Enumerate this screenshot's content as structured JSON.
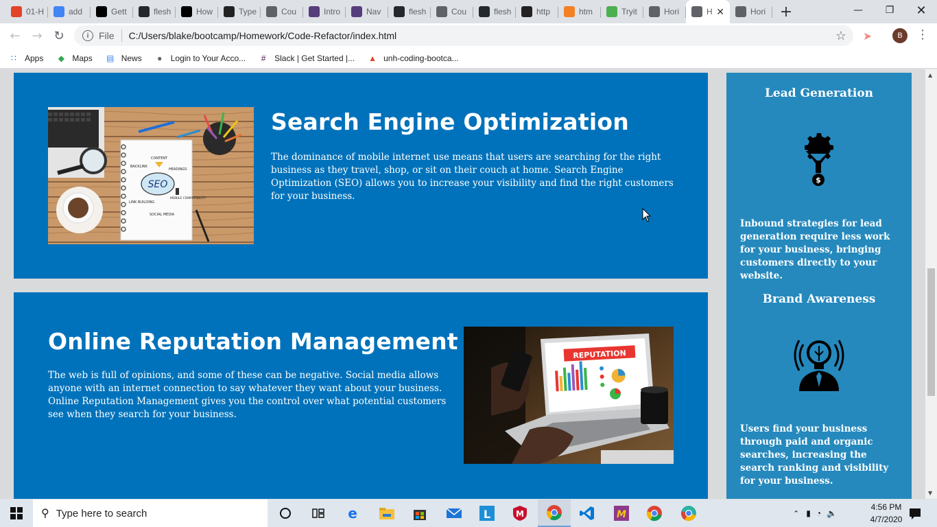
{
  "browser": {
    "tabs": [
      {
        "label": "01-H",
        "icon": "gitlab-icon",
        "color": "#e24329"
      },
      {
        "label": "add",
        "icon": "google-icon",
        "color": "#4285f4"
      },
      {
        "label": "Gett",
        "icon": "medium-icon",
        "color": "#000000"
      },
      {
        "label": "flesh",
        "icon": "github-icon",
        "color": "#24292e"
      },
      {
        "label": "How",
        "icon": "medium-icon",
        "color": "#000000"
      },
      {
        "label": "Type",
        "icon": "typeit-icon",
        "color": "#222222"
      },
      {
        "label": "Cou",
        "icon": "globe-icon",
        "color": "#5f6368"
      },
      {
        "label": "Intro",
        "icon": "bootstrap-icon",
        "color": "#563d7c"
      },
      {
        "label": "Nav",
        "icon": "bootstrap-icon",
        "color": "#563d7c"
      },
      {
        "label": "flesh",
        "icon": "github-icon",
        "color": "#24292e"
      },
      {
        "label": "Cou",
        "icon": "globe-icon",
        "color": "#5f6368"
      },
      {
        "label": "flesh",
        "icon": "github-icon",
        "color": "#24292e"
      },
      {
        "label": "http",
        "icon": "skull-icon",
        "color": "#222222"
      },
      {
        "label": "htm",
        "icon": "stackoverflow-icon",
        "color": "#f48024"
      },
      {
        "label": "Tryit",
        "icon": "w3schools-icon",
        "color": "#4caf50"
      },
      {
        "label": "Hori",
        "icon": "globe-icon",
        "color": "#5f6368"
      },
      {
        "label": "H",
        "icon": "globe-icon",
        "color": "#5f6368",
        "active": true
      },
      {
        "label": "Hori",
        "icon": "globe-icon",
        "color": "#5f6368"
      }
    ],
    "address": {
      "scheme_label": "File",
      "url": "C:/Users/blake/bootcamp/Homework/Code-Refactor/index.html"
    },
    "profile_initial": "B",
    "bookmarks": [
      {
        "label": "Apps",
        "icon": "apps-grid-icon"
      },
      {
        "label": "Maps",
        "icon": "maps-icon"
      },
      {
        "label": "News",
        "icon": "news-icon"
      },
      {
        "label": "Login to Your Acco...",
        "icon": "globe-icon"
      },
      {
        "label": "Slack | Get Started |...",
        "icon": "slack-icon"
      },
      {
        "label": "unh-coding-bootca...",
        "icon": "gitlab-icon"
      }
    ]
  },
  "page": {
    "seo": {
      "heading": "Search Engine Optimization",
      "body": "The dominance of mobile internet use means that users are searching for the right business as they travel, shop, or sit on their couch at home. Search Engine Optimization (SEO) allows you to increase your visibility and find the right customers for your business.",
      "image_words": [
        "CONTENT",
        "BACKLINK",
        "HEADINGS",
        "SEO",
        "LINK BUILDING",
        "MOBILE COMPATIBILITY",
        "SOCIAL MEDIA"
      ]
    },
    "reputation": {
      "heading": "Online Reputation Management",
      "body": "The web is full of opinions, and some of these can be negative. Social media allows anyone with an internet connection to say whatever they want about your business. Online Reputation Management gives you the control over what potential customers see when they search for your business.",
      "image_banner": "REPUTATION"
    },
    "sidebar": {
      "lead": {
        "title": "Lead Generation",
        "icon": "lead-generation-icon",
        "body": "Inbound strategies for lead generation require less work for your business, bringing customers directly to your website."
      },
      "brand": {
        "title": "Brand Awareness",
        "icon": "brand-awareness-icon",
        "body": "Users find your business through paid and organic searches, increasing the search ranking and visibility for your business."
      }
    },
    "colors": {
      "card_bg": "#0072bb",
      "sidebar_bg": "#2589bd",
      "page_bg": "#d9dadb"
    }
  },
  "taskbar": {
    "search_placeholder": "Type here to search",
    "time": "4:56 PM",
    "date": "4/7/2020"
  }
}
